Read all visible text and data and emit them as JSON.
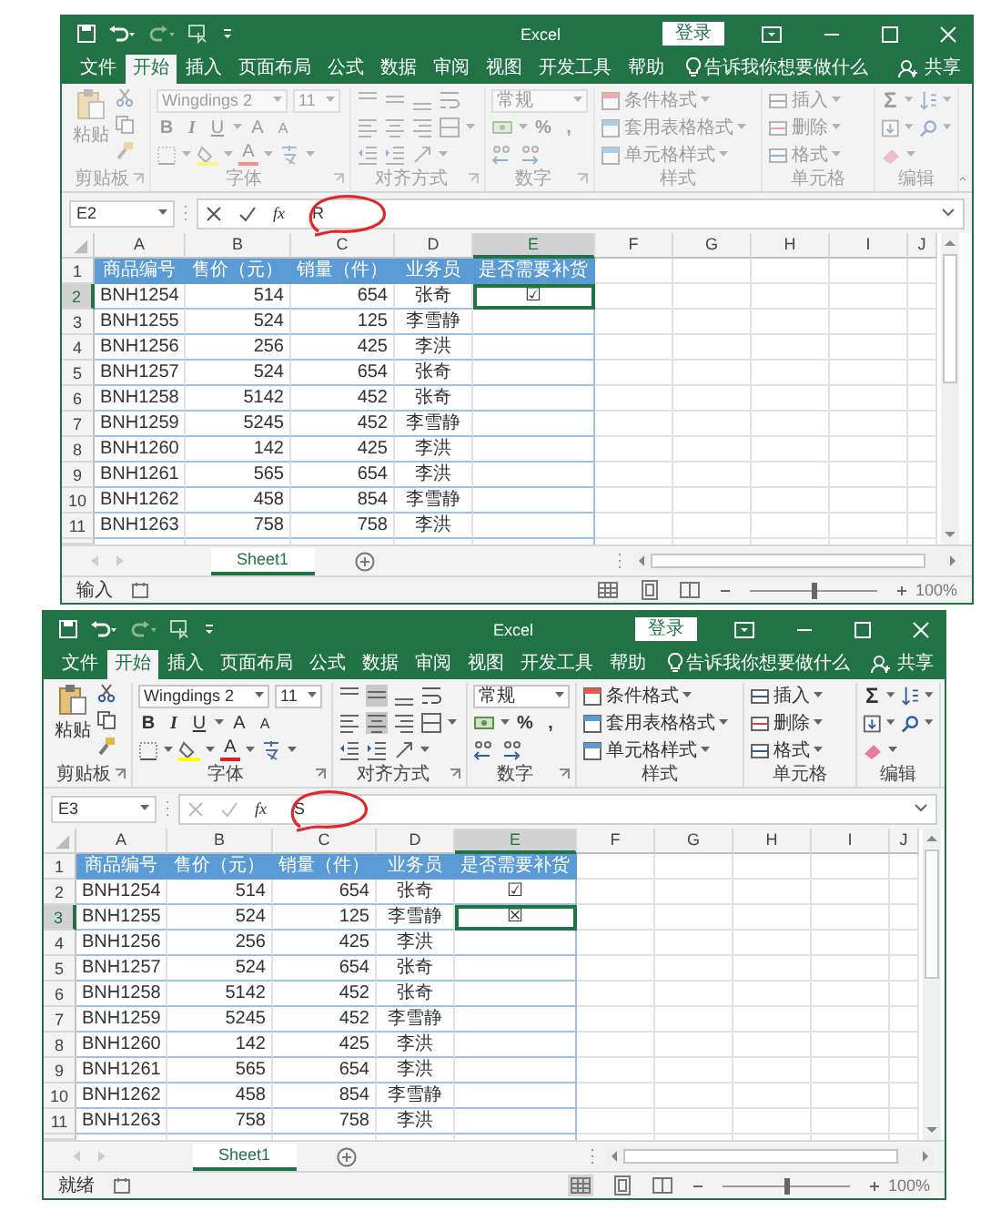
{
  "windows": [
    {
      "title": "Excel",
      "login": "登录",
      "edit_mode": true,
      "ribbon_tabs": [
        {
          "label": "文件",
          "selected": false
        },
        {
          "label": "开始",
          "selected": true
        },
        {
          "label": "插入",
          "selected": false
        },
        {
          "label": "页面布局",
          "selected": false
        },
        {
          "label": "公式",
          "selected": false
        },
        {
          "label": "数据",
          "selected": false
        },
        {
          "label": "审阅",
          "selected": false
        },
        {
          "label": "视图",
          "selected": false
        },
        {
          "label": "开发工具",
          "selected": false
        },
        {
          "label": "帮助",
          "selected": false
        }
      ],
      "tell_me": "告诉我你想要做什么",
      "share": "共享",
      "ribbon": {
        "paste": "粘贴",
        "font_name": "Wingdings 2",
        "font_size": "11",
        "style_buttons": [
          "B",
          "I",
          "U"
        ],
        "grow_font": "A",
        "shrink_font": "A",
        "font_color": "A",
        "align_center_on": false,
        "number_format": "常规",
        "percent": "%",
        "comma": ",",
        "styles": [
          "条件格式",
          "套用表格格式",
          "单元格样式"
        ],
        "cells": [
          "插入",
          "删除",
          "格式"
        ],
        "sum": "Σ",
        "groups": [
          "剪贴板",
          "字体",
          "对齐方式",
          "数字",
          "样式",
          "单元格",
          "编辑"
        ]
      },
      "name_box": "E2",
      "fx": "fx",
      "formula": "R",
      "columns": [
        {
          "label": "A",
          "selected": false
        },
        {
          "label": "B",
          "selected": false
        },
        {
          "label": "C",
          "selected": false
        },
        {
          "label": "D",
          "selected": false
        },
        {
          "label": "E",
          "selected": true
        },
        {
          "label": "F",
          "selected": false
        },
        {
          "label": "G",
          "selected": false
        },
        {
          "label": "H",
          "selected": false
        },
        {
          "label": "I",
          "selected": false
        },
        {
          "label": "J",
          "selected": false
        }
      ],
      "rows": [
        {
          "number": "1",
          "kind": "header",
          "selected": false,
          "cells": [
            "商品编号",
            "售价（元）",
            "销量（件）",
            "业务员",
            "是否需要补货"
          ]
        },
        {
          "number": "2",
          "kind": "data",
          "selected": true,
          "cells": [
            "BNH1254",
            "514",
            "654",
            "张奇",
            "☑"
          ]
        },
        {
          "number": "3",
          "kind": "data",
          "selected": false,
          "cells": [
            "BNH1255",
            "524",
            "125",
            "李雪静"
          ]
        },
        {
          "number": "4",
          "kind": "data",
          "selected": false,
          "cells": [
            "BNH1256",
            "256",
            "425",
            "李洪"
          ]
        },
        {
          "number": "5",
          "kind": "data",
          "selected": false,
          "cells": [
            "BNH1257",
            "524",
            "654",
            "张奇"
          ]
        },
        {
          "number": "6",
          "kind": "data",
          "selected": false,
          "cells": [
            "BNH1258",
            "5142",
            "452",
            "张奇"
          ]
        },
        {
          "number": "7",
          "kind": "data",
          "selected": false,
          "cells": [
            "BNH1259",
            "5245",
            "452",
            "李雪静"
          ]
        },
        {
          "number": "8",
          "kind": "data",
          "selected": false,
          "cells": [
            "BNH1260",
            "142",
            "425",
            "李洪"
          ]
        },
        {
          "number": "9",
          "kind": "data",
          "selected": false,
          "cells": [
            "BNH1261",
            "565",
            "654",
            "李洪"
          ]
        },
        {
          "number": "10",
          "kind": "data",
          "selected": false,
          "cells": [
            "BNH1262",
            "458",
            "854",
            "李雪静"
          ]
        },
        {
          "number": "11",
          "kind": "data",
          "selected": false,
          "cells": [
            "BNH1263",
            "758",
            "758",
            "李洪"
          ]
        }
      ],
      "sheet_tab": {
        "label": "Sheet1",
        "selected": true
      },
      "status": "输入",
      "zoom": {
        "level": 0.5,
        "reading": "100%"
      }
    },
    {
      "title": "Excel",
      "login": "登录",
      "edit_mode": false,
      "ribbon_tabs": [
        {
          "label": "文件",
          "selected": false
        },
        {
          "label": "开始",
          "selected": true
        },
        {
          "label": "插入",
          "selected": false
        },
        {
          "label": "页面布局",
          "selected": false
        },
        {
          "label": "公式",
          "selected": false
        },
        {
          "label": "数据",
          "selected": false
        },
        {
          "label": "审阅",
          "selected": false
        },
        {
          "label": "视图",
          "selected": false
        },
        {
          "label": "开发工具",
          "selected": false
        },
        {
          "label": "帮助",
          "selected": false
        }
      ],
      "tell_me": "告诉我你想要做什么",
      "share": "共享",
      "ribbon": {
        "paste": "粘贴",
        "font_name": "Wingdings 2",
        "font_size": "11",
        "style_buttons": [
          "B",
          "I",
          "U"
        ],
        "grow_font": "A",
        "shrink_font": "A",
        "font_color": "A",
        "align_center_on": true,
        "number_format": "常规",
        "percent": "%",
        "comma": ",",
        "styles": [
          "条件格式",
          "套用表格格式",
          "单元格样式"
        ],
        "cells": [
          "插入",
          "删除",
          "格式"
        ],
        "sum": "Σ",
        "groups": [
          "剪贴板",
          "字体",
          "对齐方式",
          "数字",
          "样式",
          "单元格",
          "编辑"
        ]
      },
      "name_box": "E3",
      "fx": "fx",
      "formula": "S",
      "columns": [
        {
          "label": "A",
          "selected": false
        },
        {
          "label": "B",
          "selected": false
        },
        {
          "label": "C",
          "selected": false
        },
        {
          "label": "D",
          "selected": false
        },
        {
          "label": "E",
          "selected": true
        },
        {
          "label": "F",
          "selected": false
        },
        {
          "label": "G",
          "selected": false
        },
        {
          "label": "H",
          "selected": false
        },
        {
          "label": "I",
          "selected": false
        },
        {
          "label": "J",
          "selected": false
        }
      ],
      "rows": [
        {
          "number": "1",
          "kind": "header",
          "selected": false,
          "cells": [
            "商品编号",
            "售价（元）",
            "销量（件）",
            "业务员",
            "是否需要补货"
          ]
        },
        {
          "number": "2",
          "kind": "data",
          "selected": false,
          "cells": [
            "BNH1254",
            "514",
            "654",
            "张奇",
            "☑"
          ]
        },
        {
          "number": "3",
          "kind": "data",
          "selected": true,
          "cells": [
            "BNH1255",
            "524",
            "125",
            "李雪静",
            "☒"
          ]
        },
        {
          "number": "4",
          "kind": "data",
          "selected": false,
          "cells": [
            "BNH1256",
            "256",
            "425",
            "李洪"
          ]
        },
        {
          "number": "5",
          "kind": "data",
          "selected": false,
          "cells": [
            "BNH1257",
            "524",
            "654",
            "张奇"
          ]
        },
        {
          "number": "6",
          "kind": "data",
          "selected": false,
          "cells": [
            "BNH1258",
            "5142",
            "452",
            "张奇"
          ]
        },
        {
          "number": "7",
          "kind": "data",
          "selected": false,
          "cells": [
            "BNH1259",
            "5245",
            "452",
            "李雪静"
          ]
        },
        {
          "number": "8",
          "kind": "data",
          "selected": false,
          "cells": [
            "BNH1260",
            "142",
            "425",
            "李洪"
          ]
        },
        {
          "number": "9",
          "kind": "data",
          "selected": false,
          "cells": [
            "BNH1261",
            "565",
            "654",
            "李洪"
          ]
        },
        {
          "number": "10",
          "kind": "data",
          "selected": false,
          "cells": [
            "BNH1262",
            "458",
            "854",
            "李雪静"
          ]
        },
        {
          "number": "11",
          "kind": "data",
          "selected": false,
          "cells": [
            "BNH1263",
            "758",
            "758",
            "李洪"
          ]
        }
      ],
      "sheet_tab": {
        "label": "Sheet1",
        "selected": true
      },
      "status": "就绪",
      "zoom": {
        "level": 0.5,
        "reading": "100%"
      }
    }
  ]
}
